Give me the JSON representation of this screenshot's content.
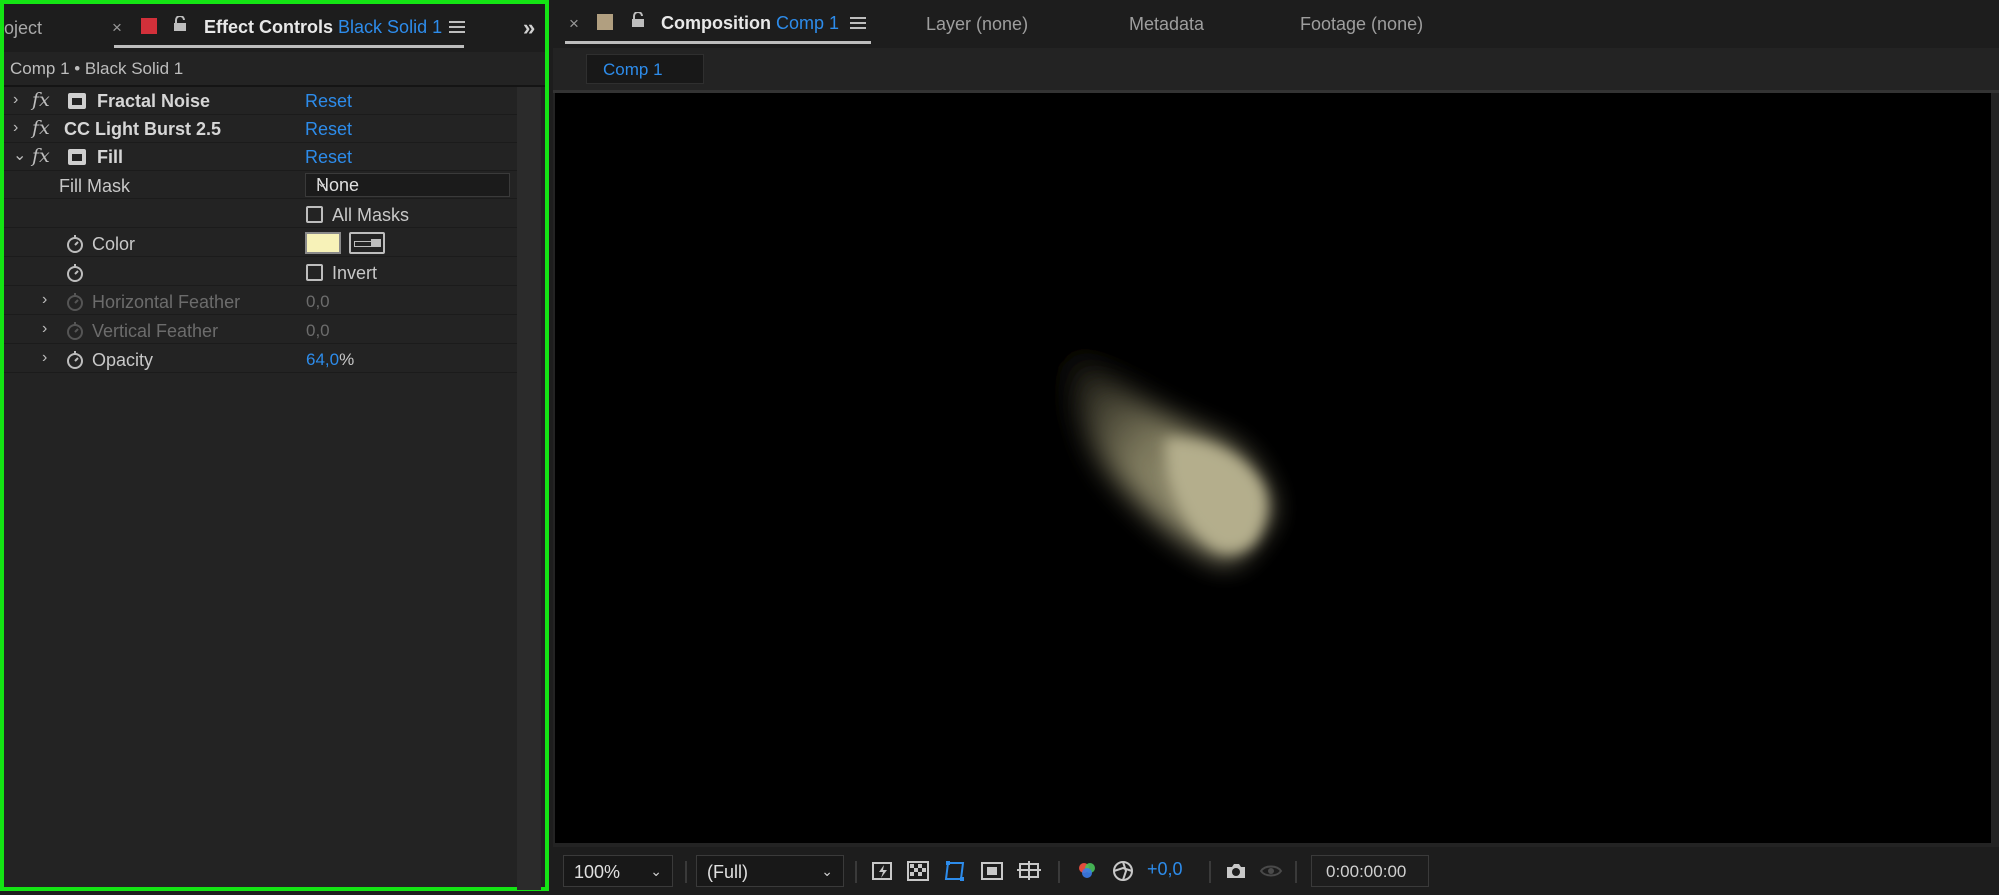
{
  "left_panel": {
    "tabs": {
      "project_partial": "oject",
      "close_glyph": "×",
      "effect_controls_title": "Effect Controls",
      "effect_controls_layer": "Black Solid 1",
      "overflow_glyph": "»"
    },
    "breadcrumb": "Comp 1 • Black Solid 1",
    "effects": [
      {
        "name": "Fractal Noise",
        "reset": "Reset",
        "expanded": false
      },
      {
        "name": "CC Light Burst 2.5",
        "reset": "Reset",
        "expanded": false
      },
      {
        "name": "Fill",
        "reset": "Reset",
        "expanded": true
      }
    ],
    "fill_properties": {
      "fill_mask_label": "Fill Mask",
      "fill_mask_value": "None",
      "all_masks_label": "All Masks",
      "color_label": "Color",
      "color_value": "#f7f2b8",
      "invert_label": "Invert",
      "horizontal_feather_label": "Horizontal Feather",
      "horizontal_feather_value": "0,0",
      "vertical_feather_label": "Vertical Feather",
      "vertical_feather_value": "0,0",
      "opacity_label": "Opacity",
      "opacity_number": "64,0",
      "opacity_unit": "%"
    }
  },
  "right_panel": {
    "tabs": {
      "close_glyph": "×",
      "composition_title": "Composition",
      "composition_name": "Comp 1",
      "layer_tab": "Layer (none)",
      "metadata_tab": "Metadata",
      "footage_tab": "Footage (none)"
    },
    "subtab": "Comp 1",
    "toolbar": {
      "zoom": "100%",
      "resolution": "(Full)",
      "exposure": "+0,0",
      "timecode": "0:00:00:00"
    }
  },
  "colors": {
    "accent_blue": "#2d8ceb",
    "highlight_green": "#14e414",
    "layer_label_red": "#d2303a",
    "comp_label_tan": "#b19f80"
  }
}
